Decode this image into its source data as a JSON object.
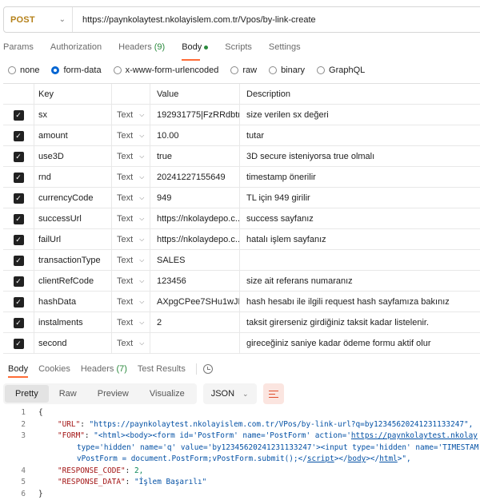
{
  "request": {
    "method": "POST",
    "url": "https://paynkolaytest.nkolayislem.com.tr/Vpos/by-link-create"
  },
  "request_tabs": [
    {
      "label": "Params"
    },
    {
      "label": "Authorization"
    },
    {
      "label": "Headers",
      "count": "(9)"
    },
    {
      "label": "Body",
      "active": true
    },
    {
      "label": "Scripts"
    },
    {
      "label": "Settings"
    }
  ],
  "body_types": [
    {
      "label": "none"
    },
    {
      "label": "form-data",
      "selected": true
    },
    {
      "label": "x-www-form-urlencoded"
    },
    {
      "label": "raw"
    },
    {
      "label": "binary"
    },
    {
      "label": "GraphQL"
    }
  ],
  "table": {
    "headers": {
      "key": "Key",
      "value": "Value",
      "description": "Description"
    },
    "rows": [
      {
        "key": "sx",
        "type": "Text",
        "value": "192931775|FzRRdbtr...",
        "description": "size verilen sx değeri"
      },
      {
        "key": "amount",
        "type": "Text",
        "value": "10.00",
        "description": "tutar"
      },
      {
        "key": "use3D",
        "type": "Text",
        "value": "true",
        "description": "3D secure isteniyorsa true olmalı"
      },
      {
        "key": "rnd",
        "type": "Text",
        "value": "20241227155649",
        "description": "timestamp önerilir"
      },
      {
        "key": "currencyCode",
        "type": "Text",
        "value": "949",
        "description": "TL için 949 girilir"
      },
      {
        "key": "successUrl",
        "type": "Text",
        "value": "https://nkolaydepo.c...",
        "description": "success sayfanız"
      },
      {
        "key": "failUrl",
        "type": "Text",
        "value": "https://nkolaydepo.c...",
        "description": "hatalı işlem sayfanız"
      },
      {
        "key": "transactionType",
        "type": "Text",
        "value": "SALES",
        "description": ""
      },
      {
        "key": "clientRefCode",
        "type": "Text",
        "value": "123456",
        "description": "size ait referans numaranız"
      },
      {
        "key": "hashData",
        "type": "Text",
        "value": "AXpgCPee7SHu1wJK...",
        "description": "hash hesabı ile ilgili request hash sayfamıza bakınız"
      },
      {
        "key": "instalments",
        "type": "Text",
        "value": "2",
        "description": "taksit girerseniz girdiğiniz taksit kadar listelenir."
      },
      {
        "key": "second",
        "type": "Text",
        "value": "",
        "description": "gireceğiniz saniye kadar ödeme formu aktif olur"
      }
    ]
  },
  "response_tabs": [
    {
      "label": "Body",
      "active": true
    },
    {
      "label": "Cookies"
    },
    {
      "label": "Headers",
      "count": "(7)"
    },
    {
      "label": "Test Results"
    }
  ],
  "view_modes": [
    {
      "label": "Pretty",
      "active": true
    },
    {
      "label": "Raw"
    },
    {
      "label": "Preview"
    },
    {
      "label": "Visualize"
    }
  ],
  "format": "JSON",
  "icons": {
    "method_dropdown": "chevron-down-icon",
    "history": "history-icon",
    "wrap": "wrap-lines-icon",
    "checkbox": "checkbox-checked-icon"
  },
  "colors": {
    "method": "#b5811a",
    "active_tab_underline": "#ff6c37",
    "count": "#2b8a3e",
    "json_key": "#a31515",
    "json_string": "#0451a5",
    "json_number": "#098658"
  },
  "code_lines": [
    {
      "num": "1",
      "text": "{"
    },
    {
      "num": "2",
      "key": "\"URL\"",
      "value": "\"https://paynkolaytest.nkolayislem.com.tr/VPos/by-link-url?q=by12345620241231133247\","
    },
    {
      "num": "3",
      "key": "\"FORM\"",
      "value_a": "\"<html><body><form id='PostForm' name='PostForm' action='",
      "value_link": "https://paynkolaytest.nkolay",
      "cont1": "type='hidden' name='q' value='by12345620241231133247'><input type='hidden' name='TIMESTAM",
      "cont2a": "vPostForm = document.PostForm;vPostForm.submit();</",
      "cont2_script": "script",
      "cont2b": "></",
      "cont2_body": "body",
      "cont2c": "></",
      "cont2_html": "html",
      "cont2d": ">\","
    },
    {
      "num": "4",
      "key": "\"RESPONSE_CODE\"",
      "value": "2,"
    },
    {
      "num": "5",
      "key": "\"RESPONSE_DATA\"",
      "value": "\"İşlem Başarılı\""
    },
    {
      "num": "6",
      "text": "}"
    }
  ]
}
